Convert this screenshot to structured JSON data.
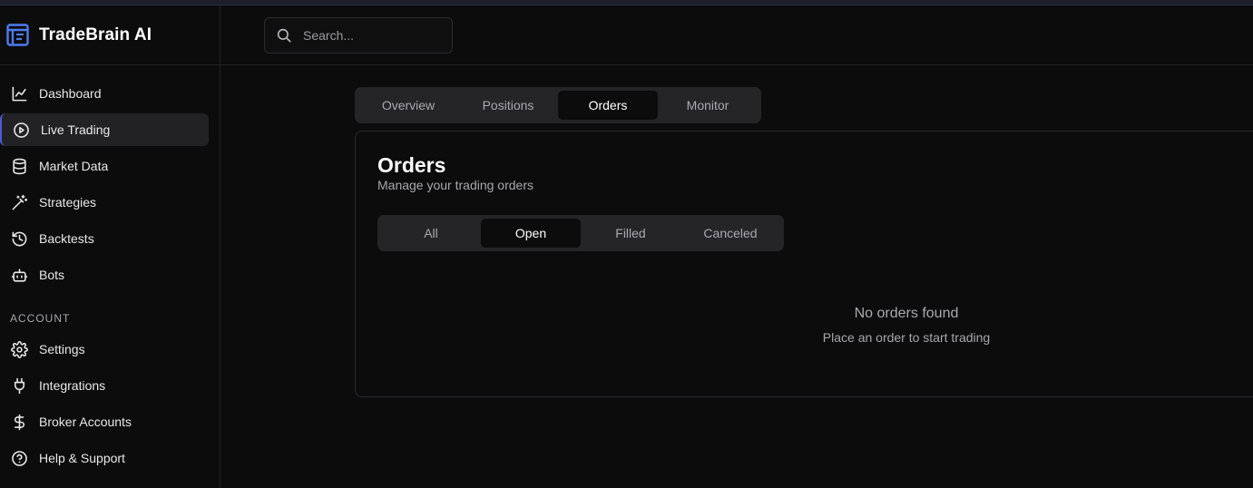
{
  "brand": {
    "name": "TradeBrain AI",
    "accent": "#4e7bf0"
  },
  "sidebar": {
    "items": [
      {
        "label": "Dashboard",
        "icon": "chart-line-icon"
      },
      {
        "label": "Live Trading",
        "icon": "play-circle-icon",
        "active": true
      },
      {
        "label": "Market Data",
        "icon": "database-icon"
      },
      {
        "label": "Strategies",
        "icon": "wand-icon"
      },
      {
        "label": "Backtests",
        "icon": "history-icon"
      },
      {
        "label": "Bots",
        "icon": "bot-icon"
      }
    ],
    "account_label": "ACCOUNT",
    "account_items": [
      {
        "label": "Settings",
        "icon": "gear-icon"
      },
      {
        "label": "Integrations",
        "icon": "plug-icon"
      },
      {
        "label": "Broker Accounts",
        "icon": "dollar-icon"
      },
      {
        "label": "Help & Support",
        "icon": "help-circle-icon"
      }
    ]
  },
  "header": {
    "search_placeholder": "Search..."
  },
  "main_tabs": [
    "Overview",
    "Positions",
    "Orders",
    "Monitor"
  ],
  "main_tab_active": "Orders",
  "orders": {
    "title": "Orders",
    "subtitle": "Manage your trading orders",
    "filters": [
      "All",
      "Open",
      "Filled",
      "Canceled"
    ],
    "filter_active": "Open",
    "empty_title": "No orders found",
    "empty_subtitle": "Place an order to start trading"
  }
}
